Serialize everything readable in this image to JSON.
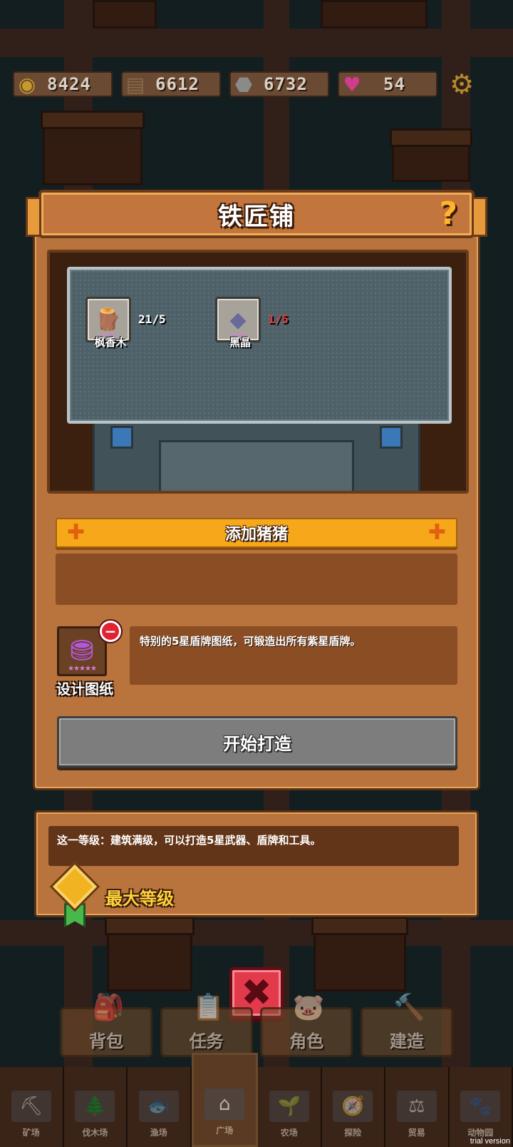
{
  "resources": [
    {
      "icon": "coin-icon",
      "glyph": "◉",
      "color": "#c59a2a",
      "value": "8424"
    },
    {
      "icon": "wood-icon",
      "glyph": "▤",
      "color": "#8a6a45",
      "value": "6612"
    },
    {
      "icon": "stone-icon",
      "glyph": "⬣",
      "color": "#8a8a8a",
      "value": "6732"
    },
    {
      "icon": "gem-icon",
      "glyph": "♥",
      "color": "#d23c8c",
      "value": "54"
    }
  ],
  "panel": {
    "title": "铁匠铺",
    "help": "?",
    "materials": [
      {
        "name": "枫香木",
        "count": "21/5",
        "count_color": "#ffffff",
        "glyph": "🪵",
        "stars": "★★★★"
      },
      {
        "name": "黑晶",
        "count": "1/5",
        "count_color": "#e23a3a",
        "glyph": "◆",
        "stars": "★★★★"
      }
    ],
    "add_pig_label": "添加猪猪",
    "blueprint": {
      "name": "设计图纸",
      "stars": "★★★★★",
      "description": "特别的5星盾牌图纸，可锻造出所有紫星盾牌。",
      "remove": "−"
    },
    "start_button": "开始打造"
  },
  "level": {
    "description": "这一等级：建筑满级，可以打造5星武器、盾牌和工具。",
    "max_label": "最大等级"
  },
  "close_glyph": "✖",
  "quick_menu": [
    {
      "label": "背包",
      "glyph": "🎒"
    },
    {
      "label": "任务",
      "glyph": "📋"
    },
    {
      "label": "角色",
      "glyph": "🐷"
    },
    {
      "label": "建造",
      "glyph": "🔨"
    }
  ],
  "nav": [
    {
      "label": "矿场",
      "glyph": "⛏"
    },
    {
      "label": "伐木场",
      "glyph": "🌲"
    },
    {
      "label": "渔场",
      "glyph": "🐟"
    },
    {
      "label": "广场",
      "glyph": "⌂",
      "active": true
    },
    {
      "label": "农场",
      "glyph": "🌱"
    },
    {
      "label": "探险",
      "glyph": "🧭"
    },
    {
      "label": "贸易",
      "glyph": "⚖"
    },
    {
      "label": "动物园",
      "glyph": "🐾"
    }
  ],
  "trial": "trial version"
}
